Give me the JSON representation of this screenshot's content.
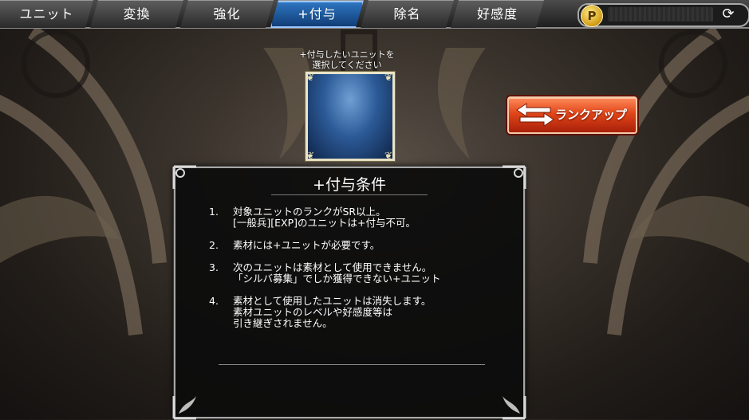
{
  "tabs": [
    {
      "label": "ユニット",
      "active": false
    },
    {
      "label": "変換",
      "active": false
    },
    {
      "label": "強化",
      "active": false
    },
    {
      "label": "+付与",
      "active": true
    },
    {
      "label": "除名",
      "active": false
    },
    {
      "label": "好感度",
      "active": false
    }
  ],
  "currency": {
    "icon": "P",
    "refresh_icon": "refresh-icon"
  },
  "slot": {
    "prompt": "+付与したいユニットを\n選択してください"
  },
  "rankup_button": {
    "label": "ランクアップ"
  },
  "conditions": {
    "title": "+付与条件",
    "items": [
      {
        "num": "1.",
        "text": "対象ユニットのランクがSR以上。\n[一般兵][EXP]のユニットは+付与不可。"
      },
      {
        "num": "2.",
        "text": "素材には+ユニットが必要です。"
      },
      {
        "num": "3.",
        "text": "次のユニットは素材として使用できません。\n「シルバ募集」でしか獲得できない+ユニット"
      },
      {
        "num": "4.",
        "text": "素材として使用したユニットは消失します。\n素材ユニットのレベルや好感度等は\n引き継ぎされません。"
      }
    ]
  },
  "colors": {
    "active_tab": "#1f5fa8",
    "rankup": "#e04518",
    "slot": "#2c5a97"
  }
}
